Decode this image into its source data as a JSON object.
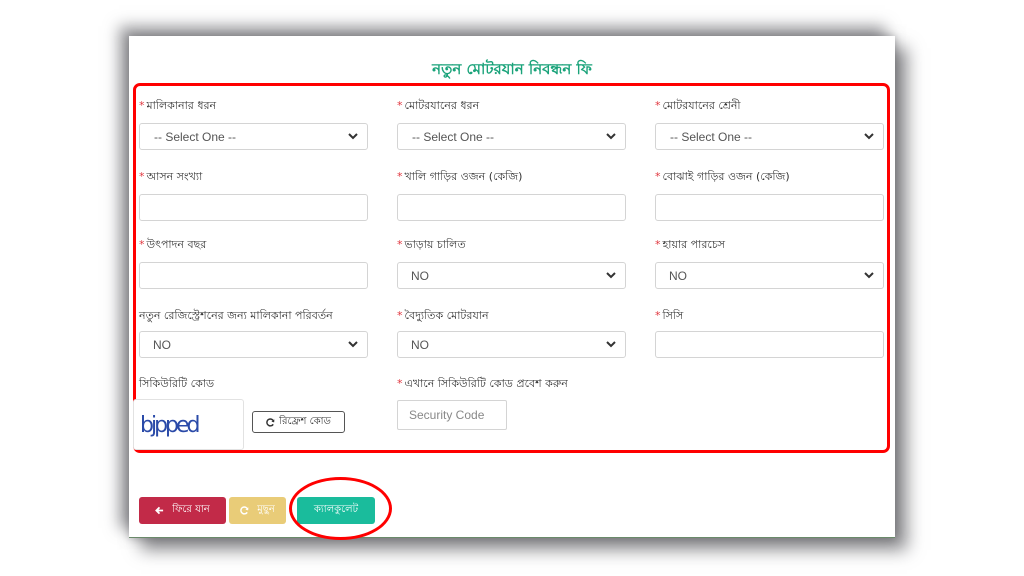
{
  "title": "নতুন মোটরযান নিবন্ধন ফি",
  "required_marker": "*",
  "fields": {
    "ownership_type": {
      "label": "মালিকানার ধরন",
      "required": true,
      "value": "-- Select One --"
    },
    "vehicle_type": {
      "label": "মোটরযানের ধরন",
      "required": true,
      "value": "-- Select One --"
    },
    "vehicle_class": {
      "label": "মোটরযানের শ্রেনী",
      "required": true,
      "value": "-- Select One --"
    },
    "seat_count": {
      "label": "আসন সংখ্যা",
      "required": true,
      "value": ""
    },
    "unladen_weight": {
      "label": "খালি গাড়ির ওজন (কেজি)",
      "required": true,
      "value": ""
    },
    "laden_weight": {
      "label": "বোঝাই গাড়ির ওজন (কেজি)",
      "required": true,
      "value": ""
    },
    "manufacture_year": {
      "label": "উৎপাদন বছর",
      "required": true,
      "value": ""
    },
    "for_hire": {
      "label": "ভাড়ায় চালিত",
      "required": true,
      "value": "NO"
    },
    "hire_purchase": {
      "label": "হায়ার পারচেস",
      "required": true,
      "value": "NO"
    },
    "ownership_transfer": {
      "label": "নতুন রেজিস্ট্রেশনের জন্য মালিকানা পরিবর্তন",
      "required": false,
      "value": "NO"
    },
    "electric_vehicle": {
      "label": "বৈদ্যুতিক মোটরযান",
      "required": true,
      "value": "NO"
    },
    "cc": {
      "label": "সিসি",
      "required": true,
      "value": ""
    }
  },
  "captcha": {
    "label": "সিকিউরিটি কোড",
    "image_text": "bjpped",
    "refresh_label": "রিফ্রেশ কোড",
    "input_label": "এখানে সিকিউরিটি কোড প্রবেশ করুন",
    "input_placeholder": "Security Code"
  },
  "buttons": {
    "back": "ফিরে যান",
    "clear": "মুছুন",
    "calculate": "ক্যালকুলেট"
  },
  "colors": {
    "title": "#1aa37a",
    "highlight": "#ff0000",
    "back": "#c22a48",
    "clear": "#e9cc78",
    "calculate": "#1abc9c",
    "required": "#e0353d"
  }
}
